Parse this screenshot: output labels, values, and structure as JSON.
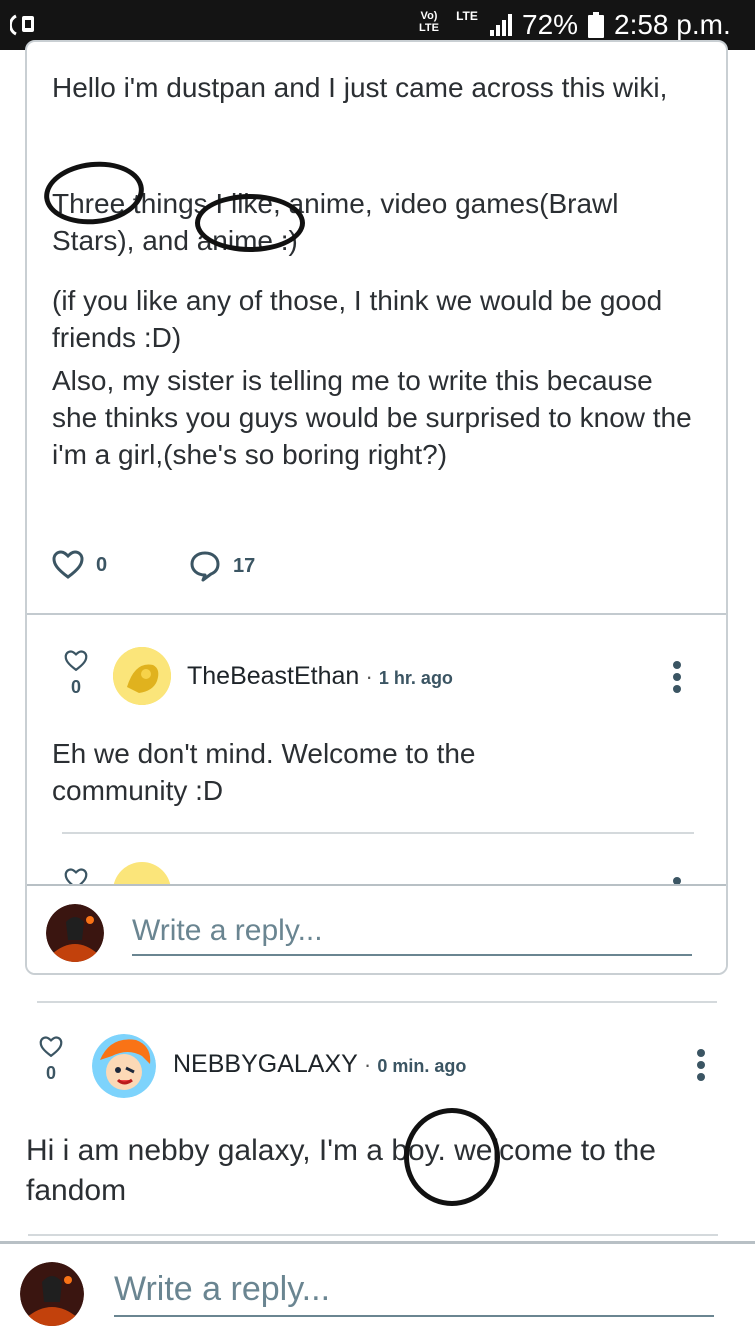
{
  "status_bar": {
    "network_top": "Vo)",
    "network_bottom": "LTE",
    "lte_label": "LTE",
    "battery": "72%",
    "time": "2:58 p.m."
  },
  "post": {
    "paragraphs": [
      "Hello i'm dustpan and I just came across this wiki,",
      "Three things I like, anime, video games(Brawl Stars), and anime :)",
      "(if you like any of those, I think we would be good friends :D)",
      "Also, my sister is telling me to write this because she thinks you guys would be surprised to know the i'm a girl,(she's so boring right?)"
    ],
    "likes": "0",
    "comments": "17"
  },
  "nested_comment": {
    "author": "TheBeastEthan",
    "time": "1 hr. ago",
    "votes": "0",
    "text": "Eh we don't mind. Welcome to the community :D"
  },
  "card_reply": {
    "placeholder": "Write a reply..."
  },
  "top_comment": {
    "author": "NEBBYGALAXY",
    "time": "0 min. ago",
    "votes": "0",
    "text": "Hi i am nebby galaxy, I'm a boy. welcome to the fandom"
  },
  "bottom_reply": {
    "placeholder": "Write a reply..."
  },
  "colors": {
    "accent": "#3b5563",
    "divider": "#c9cfd3",
    "status_bar": "#141414"
  }
}
